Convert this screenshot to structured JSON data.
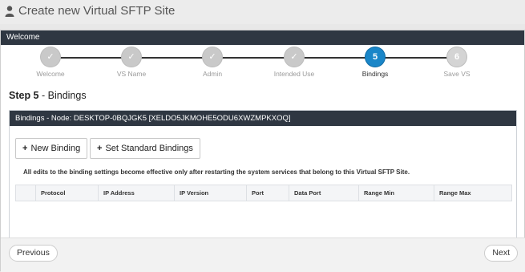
{
  "page": {
    "title": "Create new Virtual SFTP Site",
    "icon": "user-icon"
  },
  "wizard": {
    "header": "Welcome",
    "steps": [
      {
        "label": "Welcome",
        "marker": "✓",
        "state": "done"
      },
      {
        "label": "VS Name",
        "marker": "✓",
        "state": "done"
      },
      {
        "label": "Admin",
        "marker": "✓",
        "state": "done"
      },
      {
        "label": "Intended Use",
        "marker": "✓",
        "state": "done"
      },
      {
        "label": "Bindings",
        "marker": "5",
        "state": "active"
      },
      {
        "label": "Save VS",
        "marker": "6",
        "state": "future"
      }
    ],
    "step_heading": {
      "prefix": "Step 5",
      "separator": " - ",
      "title": "Bindings"
    }
  },
  "bindings": {
    "panel_title": "Bindings - Node: DESKTOP-0BQJGK5 [XELDO5JKMOHE5ODU6XWZMPKXOQ]",
    "new_binding_label": "New Binding",
    "set_standard_label": "Set Standard Bindings",
    "notice": "All edits to the binding settings become effective only after restarting the system services that belong to this Virtual SFTP Site.",
    "columns": [
      "",
      "Protocol",
      "IP Address",
      "IP Version",
      "Port",
      "Data Port",
      "Range Min",
      "Range Max"
    ]
  },
  "footer": {
    "previous_label": "Previous",
    "next_label": "Next"
  },
  "colors": {
    "header_bg": "#2f3742",
    "active_step": "#1a86c8",
    "done_step": "#c9c9c9"
  }
}
